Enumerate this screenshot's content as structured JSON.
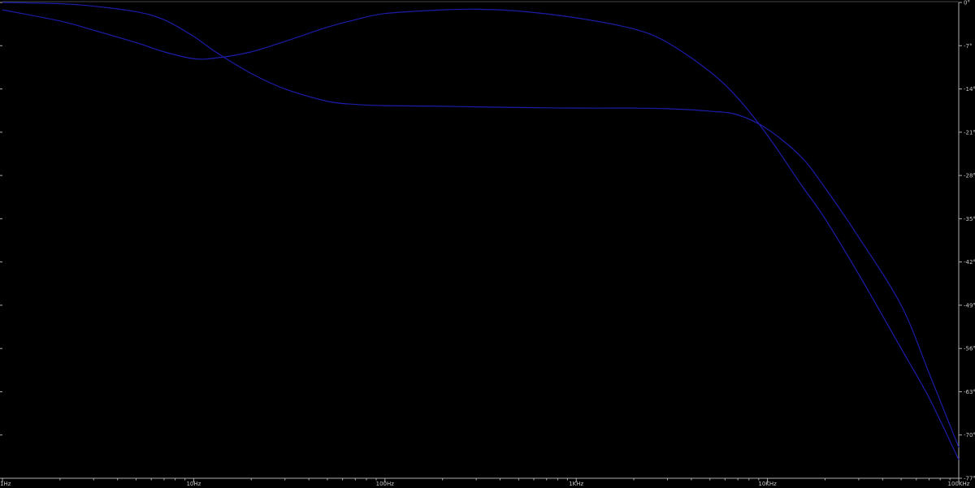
{
  "chart_data": {
    "type": "line",
    "x_scale": "log",
    "x_ticks": [
      "1Hz",
      "10Hz",
      "100Hz",
      "1KHz",
      "10KHz",
      "100KHz"
    ],
    "y_ticks": [
      "0°",
      "-7°",
      "-14°",
      "-21°",
      "-28°",
      "-35°",
      "-42°",
      "-49°",
      "-56°",
      "-63°",
      "-70°",
      "-77°"
    ],
    "xlim": [
      1,
      100000
    ],
    "ylim": [
      -77,
      0
    ],
    "grid": false,
    "colors": {
      "background": "#000000",
      "series": "#1c1ca8",
      "axis": "#b0b0b0",
      "text": "#c8c8c8"
    },
    "series": [
      {
        "x": [
          1,
          2,
          3,
          5,
          7,
          10,
          13,
          20,
          30,
          50,
          70,
          100,
          200,
          300,
          500,
          1000,
          2000,
          3000,
          5000,
          7000,
          10000,
          15000,
          20000,
          30000,
          50000,
          70000,
          100000
        ],
        "y": [
          0,
          -0.2,
          -0.6,
          -1.5,
          -2.8,
          -5.5,
          -8,
          -11.5,
          -14,
          -16,
          -16.5,
          -16.7,
          -16.8,
          -16.9,
          -17,
          -17.1,
          -17.1,
          -17.2,
          -17.6,
          -18.2,
          -20.5,
          -25,
          -30,
          -38,
          -49,
          -60,
          -72
        ]
      },
      {
        "x": [
          1,
          2,
          3,
          5,
          7,
          10,
          13,
          20,
          30,
          50,
          70,
          100,
          200,
          300,
          500,
          1000,
          2000,
          3000,
          5000,
          7000,
          10000,
          15000,
          20000,
          30000,
          50000,
          70000,
          100000
        ],
        "y": [
          -1.2,
          -3,
          -4.5,
          -6.5,
          -8,
          -9.1,
          -9,
          -8,
          -6.3,
          -4,
          -2.8,
          -1.8,
          -1.2,
          -1.1,
          -1.4,
          -2.5,
          -4.3,
          -6.5,
          -11.2,
          -15.5,
          -21.5,
          -29.5,
          -35,
          -44,
          -56,
          -64,
          -74
        ]
      }
    ]
  }
}
